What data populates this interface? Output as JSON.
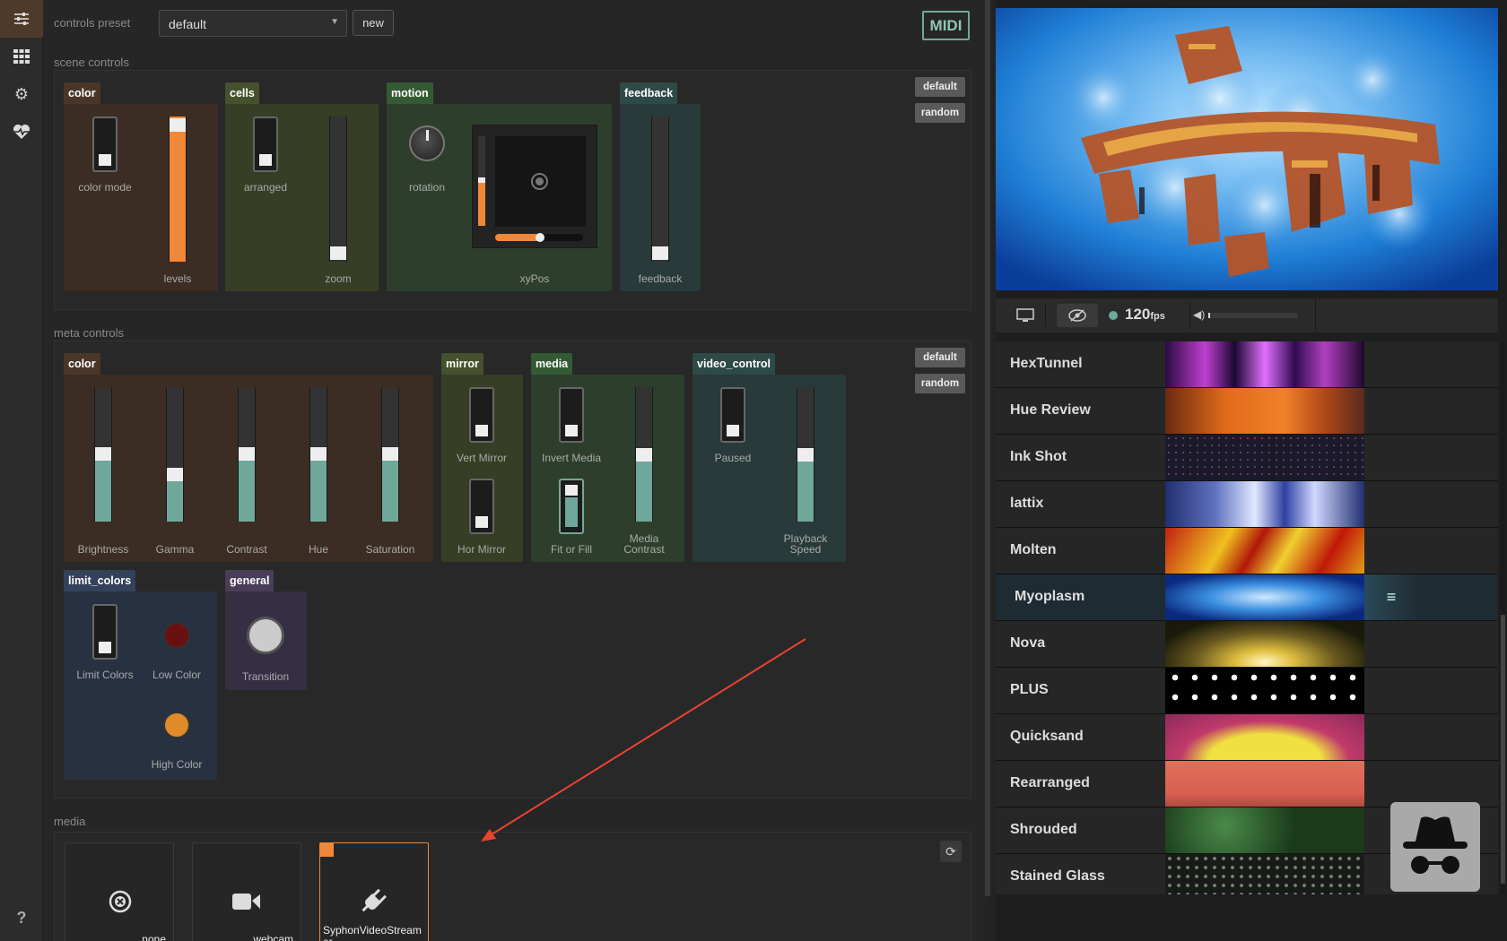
{
  "sidebar": {
    "items": [
      {
        "icon": "sliders-icon",
        "glyph": "☰"
      },
      {
        "icon": "grid-icon",
        "glyph": "▦"
      },
      {
        "icon": "gear-icon",
        "glyph": "⚙"
      },
      {
        "icon": "heart-pulse-icon",
        "glyph": "♥"
      }
    ],
    "help": "?"
  },
  "presets": {
    "label": "controls preset",
    "value": "default",
    "new_label": "new",
    "midi_label": "MIDI"
  },
  "scene": {
    "title": "scene controls",
    "default_label": "default",
    "random_label": "random",
    "color": {
      "tab": "color",
      "color_mode": "color mode",
      "levels": "levels",
      "levels_value": 1.0
    },
    "cells": {
      "tab": "cells",
      "arranged": "arranged",
      "zoom": "zoom",
      "zoom_value": 0.0
    },
    "motion": {
      "tab": "motion",
      "rotation": "rotation",
      "xypos": "xyPos",
      "xpos_value": 0.5,
      "ypos_value": 0.55
    },
    "feedback": {
      "tab": "feedback",
      "feedback": "feedback",
      "feedback_value": 0.0
    }
  },
  "meta": {
    "title": "meta controls",
    "default_label": "default",
    "random_label": "random",
    "color": {
      "tab": "color",
      "sliders": [
        {
          "label": "Brightness",
          "value": 0.5
        },
        {
          "label": "Gamma",
          "value": 0.33
        },
        {
          "label": "Contrast",
          "value": 0.5
        },
        {
          "label": "Hue",
          "value": 0.5
        },
        {
          "label": "Saturation",
          "value": 0.5
        }
      ]
    },
    "mirror": {
      "tab": "mirror",
      "vert": "Vert Mirror",
      "hor": "Hor Mirror"
    },
    "media": {
      "tab": "media",
      "invert": "Invert Media",
      "fit": "Fit or Fill",
      "contrast_l1": "Media",
      "contrast_l2": "Contrast",
      "contrast_value": 0.5
    },
    "video_control": {
      "tab": "video_control",
      "paused": "Paused",
      "speed_l1": "Playback",
      "speed_l2": "Speed",
      "speed_value": 0.5
    },
    "limit_colors": {
      "tab": "limit_colors",
      "limit": "Limit Colors",
      "low": "Low Color",
      "high": "High Color",
      "low_color": "#6a1010",
      "high_color": "#e08a2a"
    },
    "general": {
      "tab": "general",
      "transition": "Transition"
    }
  },
  "media": {
    "title": "media",
    "cards": [
      {
        "name": "none",
        "icon": "close-circle-icon"
      },
      {
        "name": "webcam",
        "icon": "video-camera-icon"
      },
      {
        "name": "SyphonVideoStreamer",
        "icon": "plug-icon"
      }
    ]
  },
  "player": {
    "fps": "120",
    "fps_unit": "fps"
  },
  "scenes": [
    {
      "name": "HexTunnel"
    },
    {
      "name": "Hue Review"
    },
    {
      "name": "Ink Shot"
    },
    {
      "name": "lattix"
    },
    {
      "name": "Molten"
    },
    {
      "name": "Myoplasm",
      "selected": true
    },
    {
      "name": "Nova"
    },
    {
      "name": "PLUS"
    },
    {
      "name": "Quicksand"
    },
    {
      "name": "Rearranged"
    },
    {
      "name": "Shrouded"
    },
    {
      "name": "Stained Glass"
    }
  ],
  "colors": {
    "accent": "#f0883a",
    "teal": "#6fa89a",
    "red_arrow": "#e8442e"
  }
}
